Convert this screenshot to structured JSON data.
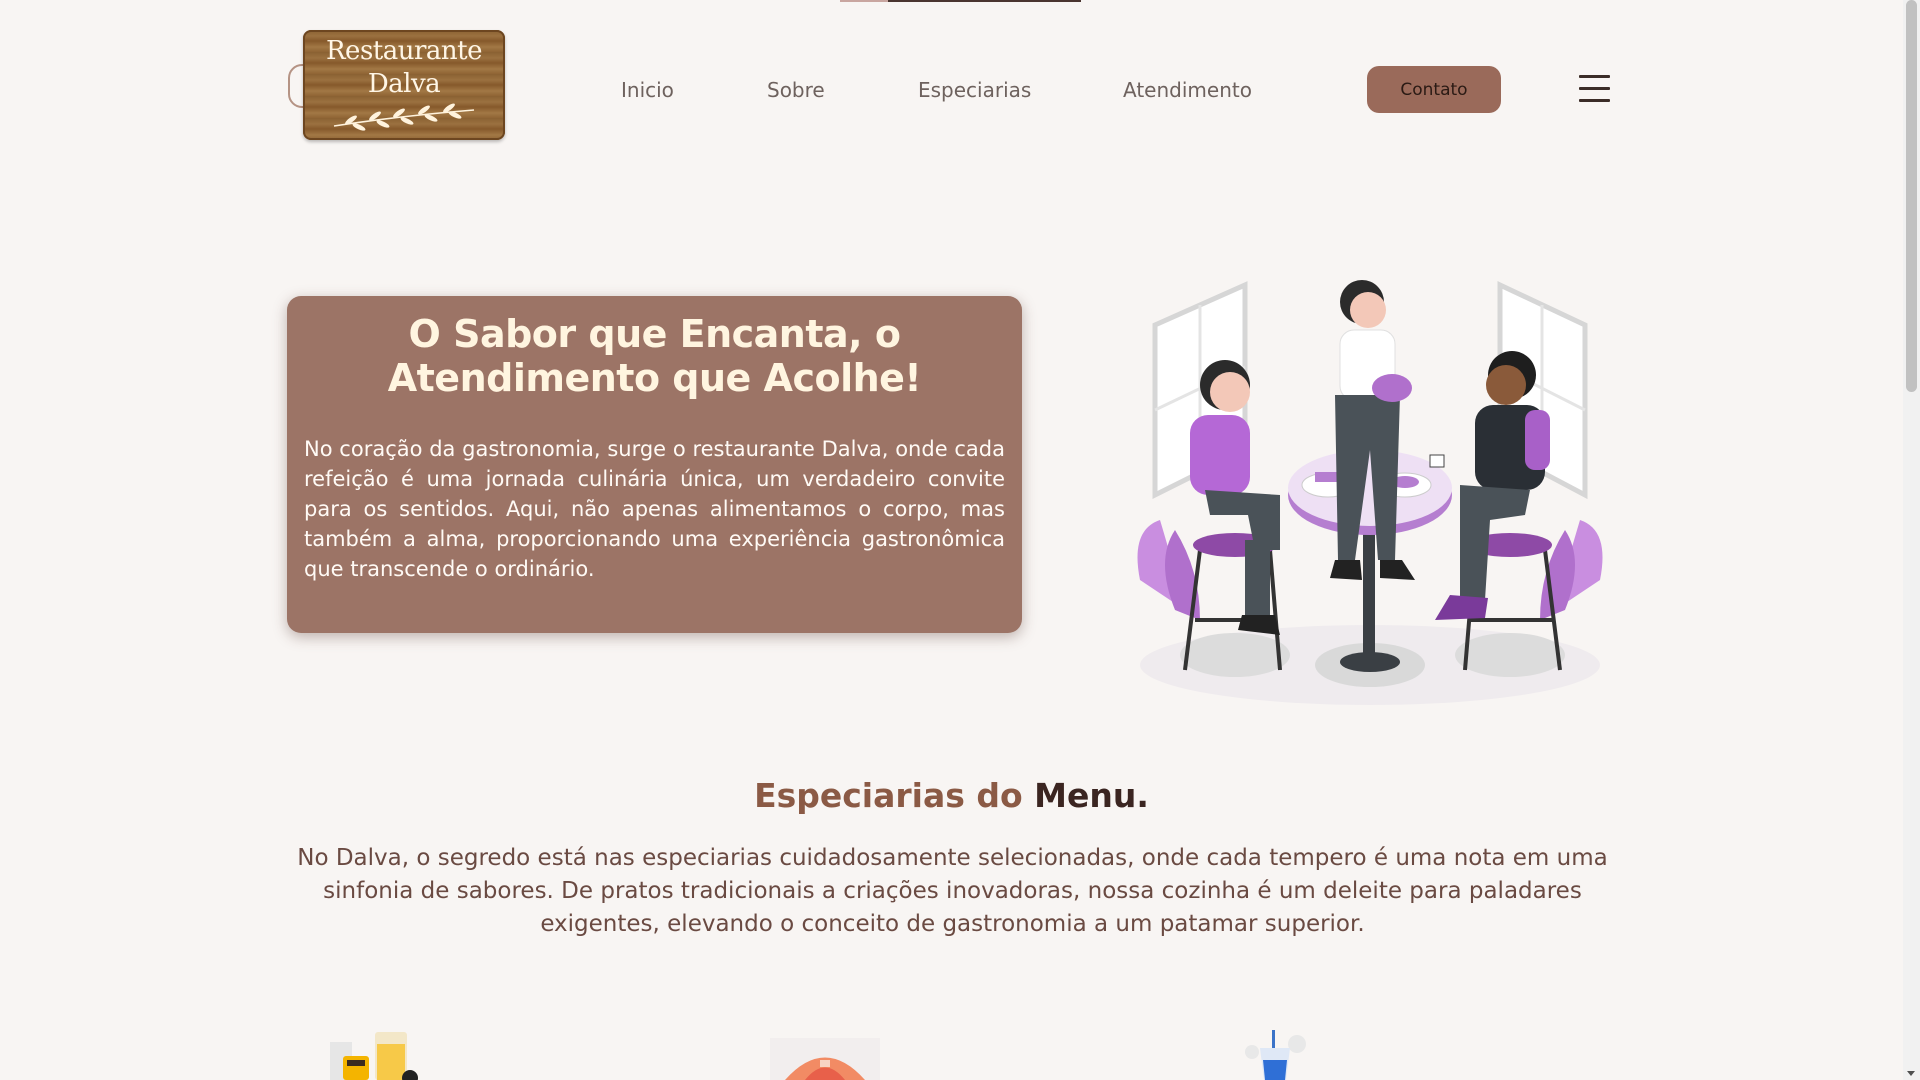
{
  "header": {
    "logo": {
      "line1": "Restaurante",
      "line2": "Dalva"
    },
    "nav": [
      {
        "label": "Inicio"
      },
      {
        "label": "Sobre"
      },
      {
        "label": "Especiarias"
      },
      {
        "label": "Atendimento"
      }
    ],
    "contact_button": "Contato",
    "menu_icon": "hamburger-menu-icon"
  },
  "hero": {
    "title_line1": "O Sabor que Encanta, o",
    "title_line2": "Atendimento que Acolhe!",
    "paragraph": "No coração da gastronomia, surge o restaurante Dalva, onde cada refeição é uma jornada culinária única, um verdadeiro convite para os sentidos. Aqui, não apenas alimentamos o corpo, mas também a alma, proporcionando uma experiência gastronômica que transcende o ordinário.",
    "illustration": "people-at-cafe-table-illustration"
  },
  "specialties": {
    "title_part1": "Especiarias do",
    "title_part2": "Menu.",
    "paragraph": "No Dalva, o segredo está nas especiarias cuidadosamente selecionadas, onde cada tempero é uma nota em uma sinfonia de sabores. De pratos tradicionais a criações inovadoras, nossa cozinha é um deleite para paladares exigentes, elevando o conceito de gastronomia a um patamar superior.",
    "cards": [
      {
        "icon": "breakfast-drinks-icon"
      },
      {
        "icon": "pizza-icon"
      },
      {
        "icon": "soda-cup-icon"
      }
    ]
  },
  "colors": {
    "background": "#f8f5f3",
    "accent_brown": "#9c7466",
    "button": "#9a6a5a",
    "title_brown": "#8b5a45",
    "dark_brown": "#3b2521",
    "illustration_purple": "#a860c8"
  }
}
